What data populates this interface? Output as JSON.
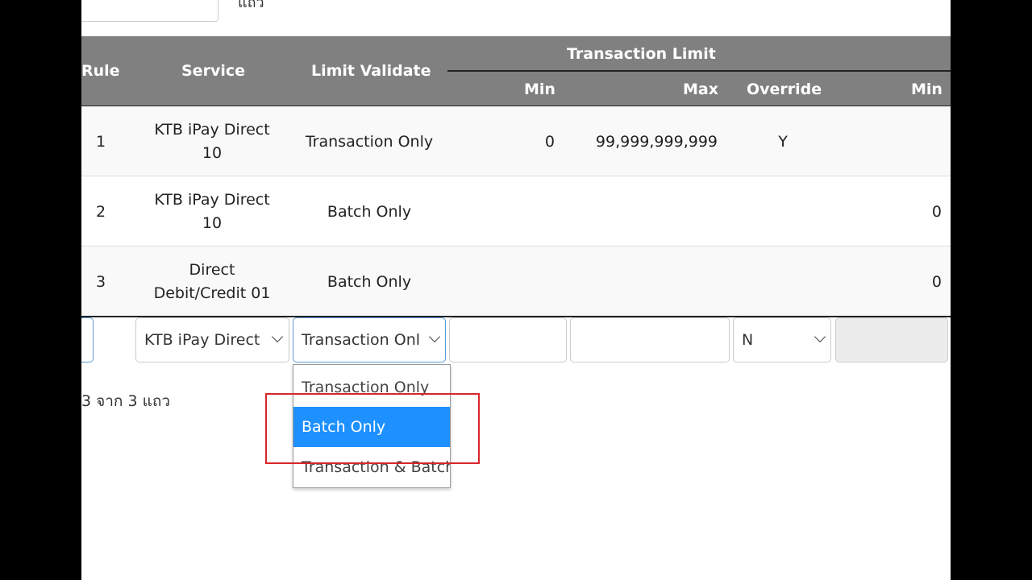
{
  "top": {
    "label_partial": "แถว"
  },
  "table": {
    "headers": {
      "rule": "Rule",
      "service": "Service",
      "limit_validate": "Limit Validate",
      "transaction_limit": "Transaction Limit",
      "min": "Min",
      "max": "Max",
      "override": "Override",
      "min2": "Min"
    },
    "rows": [
      {
        "rule": "1",
        "service_line1": "KTB iPay Direct",
        "service_line2": "10",
        "limit_validate": "Transaction Only",
        "min": "0",
        "max": "99,999,999,999",
        "override": "Y",
        "min2": ""
      },
      {
        "rule": "2",
        "service_line1": "KTB iPay Direct",
        "service_line2": "10",
        "limit_validate": "Batch Only",
        "min": "",
        "max": "",
        "override": "",
        "min2": "0"
      },
      {
        "rule": "3",
        "service_line1": "Direct",
        "service_line2": "Debit/Credit 01",
        "limit_validate": "Batch Only",
        "min": "",
        "max": "",
        "override": "",
        "min2": "0"
      }
    ]
  },
  "form_row": {
    "service_select": "KTB iPay Direct",
    "limit_validate_select": "Transaction Onl",
    "min_input": "",
    "max_input": "",
    "override_select": "N",
    "min2_input": ""
  },
  "dropdown": {
    "options": [
      "Transaction Only",
      "Batch Only",
      "Transaction & Batch"
    ],
    "highlighted": "Batch Only"
  },
  "pager": {
    "text": "3 จาก 3 แถว"
  },
  "colors": {
    "header_bg": "#808080",
    "selected_option": "#1e90ff",
    "annotation_box": "#d9252c"
  }
}
